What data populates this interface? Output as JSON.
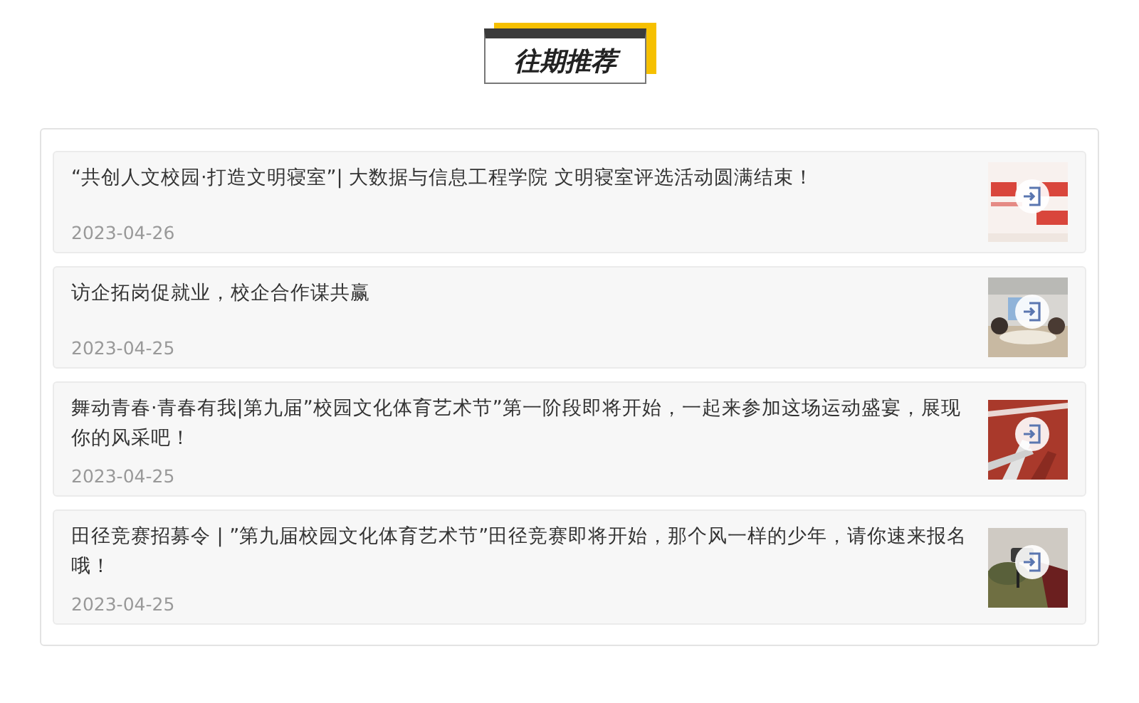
{
  "section_title": "往期推荐",
  "articles": [
    {
      "title": "“共创人文校园·打造文明寝室”| 大数据与信息工程学院 文明寝室评选活动圆满结束！",
      "date": "2023-04-26"
    },
    {
      "title": "访企拓岗促就业，校企合作谋共赢",
      "date": "2023-04-25"
    },
    {
      "title": "舞动青春·青春有我|第九届”校园文化体育艺术节”第一阶段即将开始，一起来参加这场运动盛宴，展现你的风采吧！",
      "date": "2023-04-25"
    },
    {
      "title": "田径竞赛招募令 | ”第九届校园文化体育艺术节”田径竞赛即将开始，那个风一样的少年，请你速来报名哦！",
      "date": "2023-04-25"
    }
  ]
}
